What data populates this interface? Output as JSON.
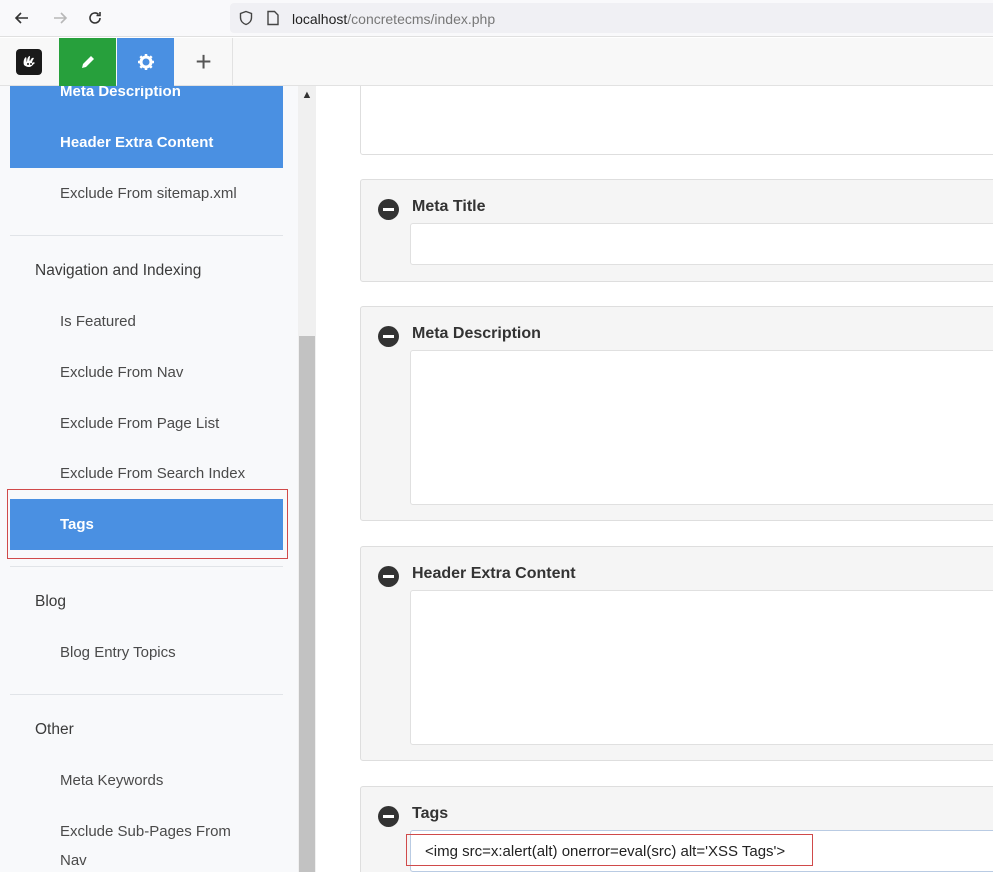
{
  "browser": {
    "url_host": "localhost",
    "url_path": "/concretecms/index.php"
  },
  "sidebar": {
    "items_top": [
      {
        "label": "Meta Description",
        "active": true
      },
      {
        "label": "Header Extra Content",
        "active": true
      },
      {
        "label": "Exclude From sitemap.xml",
        "active": false
      }
    ],
    "nav_heading": "Navigation and Indexing",
    "nav_items": [
      {
        "label": "Is Featured",
        "active": false
      },
      {
        "label": "Exclude From Nav",
        "active": false
      },
      {
        "label": "Exclude From Page List",
        "active": false
      },
      {
        "label": "Exclude From Search Index",
        "active": false
      },
      {
        "label": "Tags",
        "active": true
      }
    ],
    "blog_heading": "Blog",
    "blog_items": [
      {
        "label": "Blog Entry Topics",
        "active": false
      }
    ],
    "other_heading": "Other",
    "other_items": [
      {
        "label": "Meta Keywords",
        "active": false
      },
      {
        "label": "Exclude Sub-Pages From Nav",
        "active": false
      }
    ]
  },
  "main": {
    "panels": [
      {
        "title": "Meta Title",
        "value": ""
      },
      {
        "title": "Meta Description",
        "value": ""
      },
      {
        "title": "Header Extra Content",
        "value": ""
      },
      {
        "title": "Tags",
        "value": "<img src=x:alert(alt) onerror=eval(src) alt='XSS Tags'>"
      }
    ]
  },
  "colors": {
    "accent": "#4a90e2",
    "edit_green": "#27a03c",
    "highlight_red": "#d04a4a"
  },
  "icons": [
    "back-arrow-icon",
    "forward-arrow-icon",
    "reload-icon",
    "shield-icon",
    "page-icon",
    "concrete-logo-icon",
    "pencil-icon",
    "gear-icon",
    "plus-icon",
    "minus-circle-icon",
    "chevron-up-icon"
  ]
}
